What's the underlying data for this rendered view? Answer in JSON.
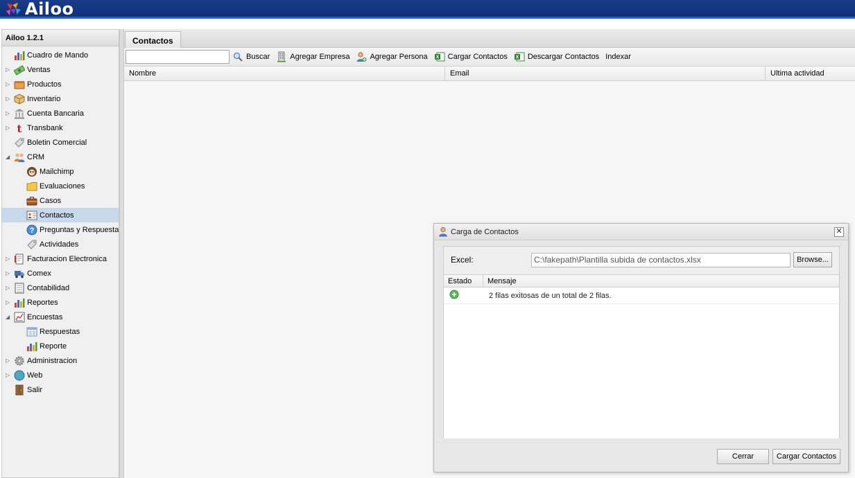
{
  "app": {
    "logo_text": "Ailoo",
    "version": "Ailoo 1.2.1"
  },
  "colors": {
    "banner": "#1b3a8a",
    "selection": "#c8d9ec",
    "success": "#3fa83a"
  },
  "sidebar": {
    "items": [
      {
        "label": "Cuadro de Mando",
        "icon": "bar-chart-icon",
        "expand": "none"
      },
      {
        "label": "Ventas",
        "icon": "money-icon",
        "expand": "collapsed"
      },
      {
        "label": "Productos",
        "icon": "box-icon",
        "expand": "collapsed"
      },
      {
        "label": "Inventario",
        "icon": "package-icon",
        "expand": "collapsed"
      },
      {
        "label": "Cuenta Bancaria",
        "icon": "bank-icon",
        "expand": "collapsed"
      },
      {
        "label": "Transbank",
        "icon": "transbank-icon",
        "expand": "collapsed"
      },
      {
        "label": "Boletin Comercial",
        "icon": "tag-icon",
        "expand": "none"
      },
      {
        "label": "CRM",
        "icon": "users-icon",
        "expand": "expanded"
      },
      {
        "label": "Mailchimp",
        "icon": "mailchimp-icon",
        "child": true
      },
      {
        "label": "Evaluaciones",
        "icon": "folder-icon",
        "child": true
      },
      {
        "label": "Casos",
        "icon": "briefcase-icon",
        "child": true
      },
      {
        "label": "Contactos",
        "icon": "contact-card-icon",
        "child": true,
        "selected": true
      },
      {
        "label": "Preguntas y Respuestas",
        "icon": "help-icon",
        "child": true
      },
      {
        "label": "Actividades",
        "icon": "tag-icon",
        "child": true
      },
      {
        "label": "Facturacion Electronica",
        "icon": "invoice-icon",
        "expand": "collapsed"
      },
      {
        "label": "Comex",
        "icon": "truck-icon",
        "expand": "collapsed"
      },
      {
        "label": "Contabilidad",
        "icon": "ledger-icon",
        "expand": "collapsed"
      },
      {
        "label": "Reportes",
        "icon": "bar-chart-icon",
        "expand": "collapsed"
      },
      {
        "label": "Encuestas",
        "icon": "survey-icon",
        "expand": "expanded"
      },
      {
        "label": "Respuestas",
        "icon": "table-icon",
        "child": true
      },
      {
        "label": "Reporte",
        "icon": "bar-chart-icon",
        "child": true
      },
      {
        "label": "Administracion",
        "icon": "gear-icon",
        "expand": "collapsed"
      },
      {
        "label": "Web",
        "icon": "globe-icon",
        "expand": "collapsed"
      },
      {
        "label": "Salir",
        "icon": "door-icon",
        "expand": "none"
      }
    ]
  },
  "main": {
    "tab": "Contactos",
    "toolbar": {
      "search_value": "",
      "buscar": "Buscar",
      "agregar_empresa": "Agregar Empresa",
      "agregar_persona": "Agregar Persona",
      "cargar_contactos": "Cargar Contactos",
      "descargar_contactos": "Descargar Contactos",
      "indexar": "Indexar"
    },
    "columns": [
      "Nombre",
      "Email",
      "Ultima actividad"
    ]
  },
  "dialog": {
    "title": "Carga de Contactos",
    "excel_label": "Excel:",
    "file_value": "C:\\fakepath\\Plantilla subida de contactos.xlsx",
    "browse_label": "Browse...",
    "columns": [
      "Estado",
      "Mensaje"
    ],
    "rows": [
      {
        "status": "success-icon",
        "message": "2 filas exitosas de un total de 2 filas."
      }
    ],
    "close_label": "Cerrar",
    "load_label": "Cargar Contactos"
  }
}
